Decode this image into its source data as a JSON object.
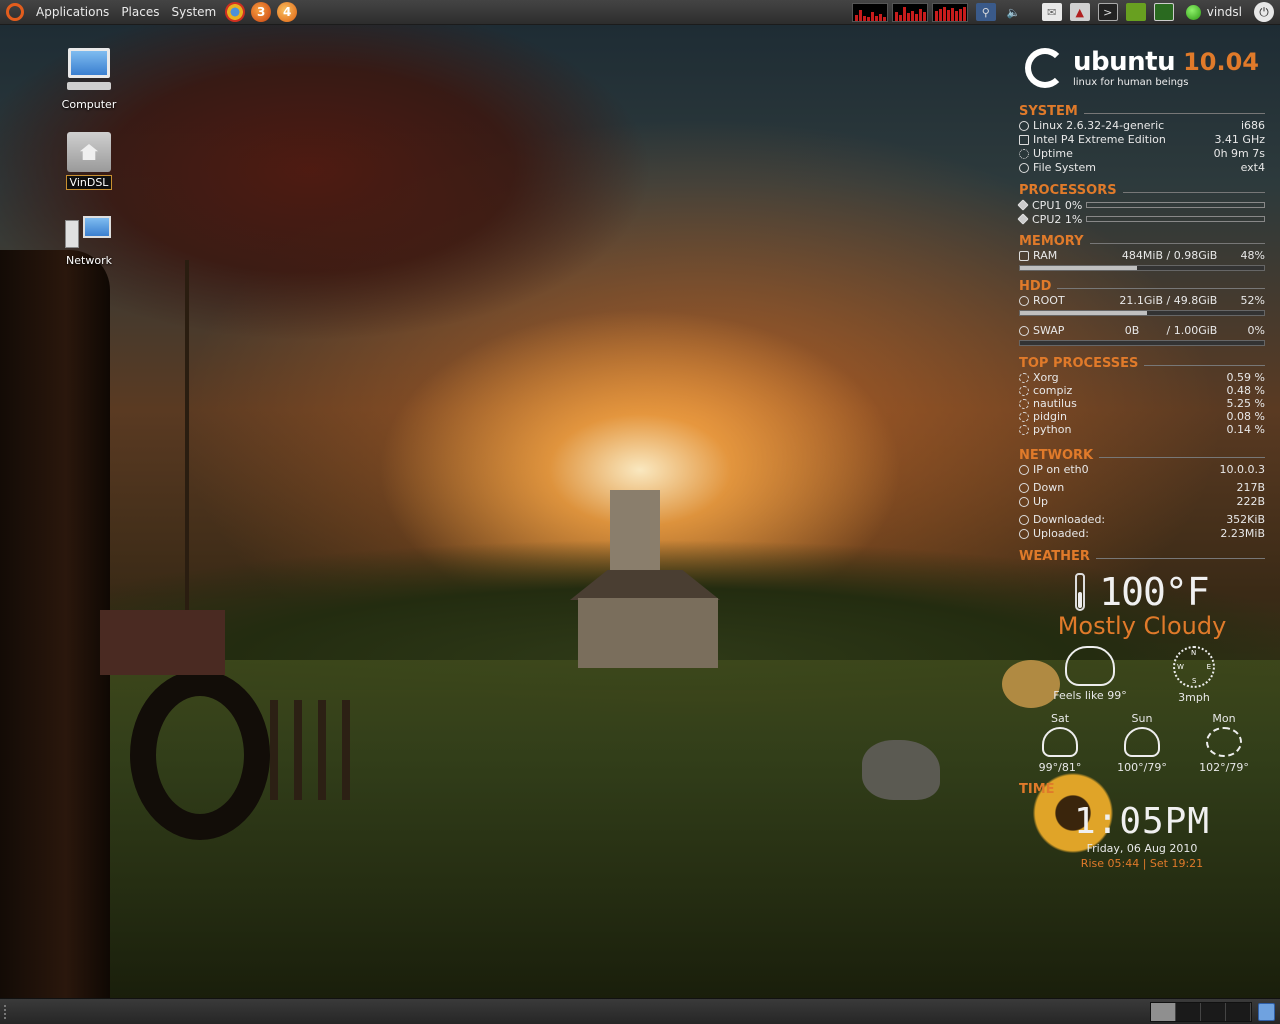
{
  "top_panel": {
    "menus": [
      "Applications",
      "Places",
      "System"
    ],
    "launchers": [
      {
        "name": "chrome-icon",
        "glyph": "",
        "color": "#4a90d9"
      },
      {
        "name": "firefox-3-icon",
        "glyph": "3",
        "color": "#e06020"
      },
      {
        "name": "firefox-4-icon",
        "glyph": "4",
        "color": "#f08a20"
      }
    ],
    "user": "vindsl"
  },
  "desktop_icons": [
    {
      "name": "computer",
      "label": "Computer"
    },
    {
      "name": "home-folder",
      "label": "VinDSL"
    },
    {
      "name": "network",
      "label": "Network"
    }
  ],
  "conky": {
    "logo": {
      "word": "ubuntu",
      "version": "10.04",
      "tagline": "linux for human beings"
    },
    "system": {
      "title": "SYSTEM",
      "rows": [
        {
          "label": "Linux 2.6.32-24-generic",
          "value": "i686"
        },
        {
          "label": "Intel P4 Extreme Edition",
          "value": "3.41 GHz"
        },
        {
          "label": "Uptime",
          "value": "0h 9m 7s"
        },
        {
          "label": "File System",
          "value": "ext4"
        }
      ]
    },
    "processors": {
      "title": "PROCESSORS",
      "rows": [
        {
          "label": "CPU1",
          "value": "0%",
          "level": 0
        },
        {
          "label": "CPU2",
          "value": "1%",
          "level": 1
        }
      ]
    },
    "memory": {
      "title": "MEMORY",
      "label": "RAM",
      "used": "484MiB",
      "total": "/ 0.98GiB",
      "percent": "48%",
      "level": 48
    },
    "hdd": {
      "title": "HDD",
      "rows": [
        {
          "label": "ROOT",
          "used": "21.1GiB",
          "total": "/ 49.8GiB",
          "percent": "52%",
          "level": 52
        },
        {
          "label": "SWAP",
          "used": "0B",
          "total": "/ 1.00GiB",
          "percent": "0%",
          "level": 0
        }
      ]
    },
    "top_processes": {
      "title": "TOP PROCESSES",
      "rows": [
        {
          "name": "Xorg",
          "value": "0.59 %"
        },
        {
          "name": "compiz",
          "value": "0.48 %"
        },
        {
          "name": "nautilus",
          "value": "5.25 %"
        },
        {
          "name": "pidgin",
          "value": "0.08 %"
        },
        {
          "name": "python",
          "value": "0.14 %"
        }
      ]
    },
    "network": {
      "title": "NETWORK",
      "ip_label": "IP on eth0",
      "ip": "10.0.0.3",
      "down_label": "Down",
      "down": "217B",
      "up_label": "Up",
      "up": "222B",
      "downloaded_label": "Downloaded:",
      "downloaded": "352KiB",
      "uploaded_label": "Uploaded:",
      "uploaded": "2.23MiB"
    },
    "weather": {
      "title": "WEATHER",
      "temp": "100°F",
      "condition": "Mostly Cloudy",
      "feels_like": "Feels like 99°",
      "wind": "3mph",
      "compass": {
        "n": "N",
        "e": "E",
        "s": "S",
        "w": "W"
      },
      "forecast": [
        {
          "day": "Sat",
          "temps": "99°/81°",
          "icon": "rain-cloud-icon"
        },
        {
          "day": "Sun",
          "temps": "100°/79°",
          "icon": "rain-cloud-icon"
        },
        {
          "day": "Mon",
          "temps": "102°/79°",
          "icon": "sun-icon"
        }
      ]
    },
    "time": {
      "title": "TIME",
      "clock": "1:05PM",
      "date": "Friday, 06 Aug 2010",
      "sunrise": "Rise 05:44",
      "separator": "|",
      "sunset": "Set 19:21"
    }
  },
  "colors": {
    "accent": "#e07a2a",
    "panel": "#2d2d2d"
  }
}
